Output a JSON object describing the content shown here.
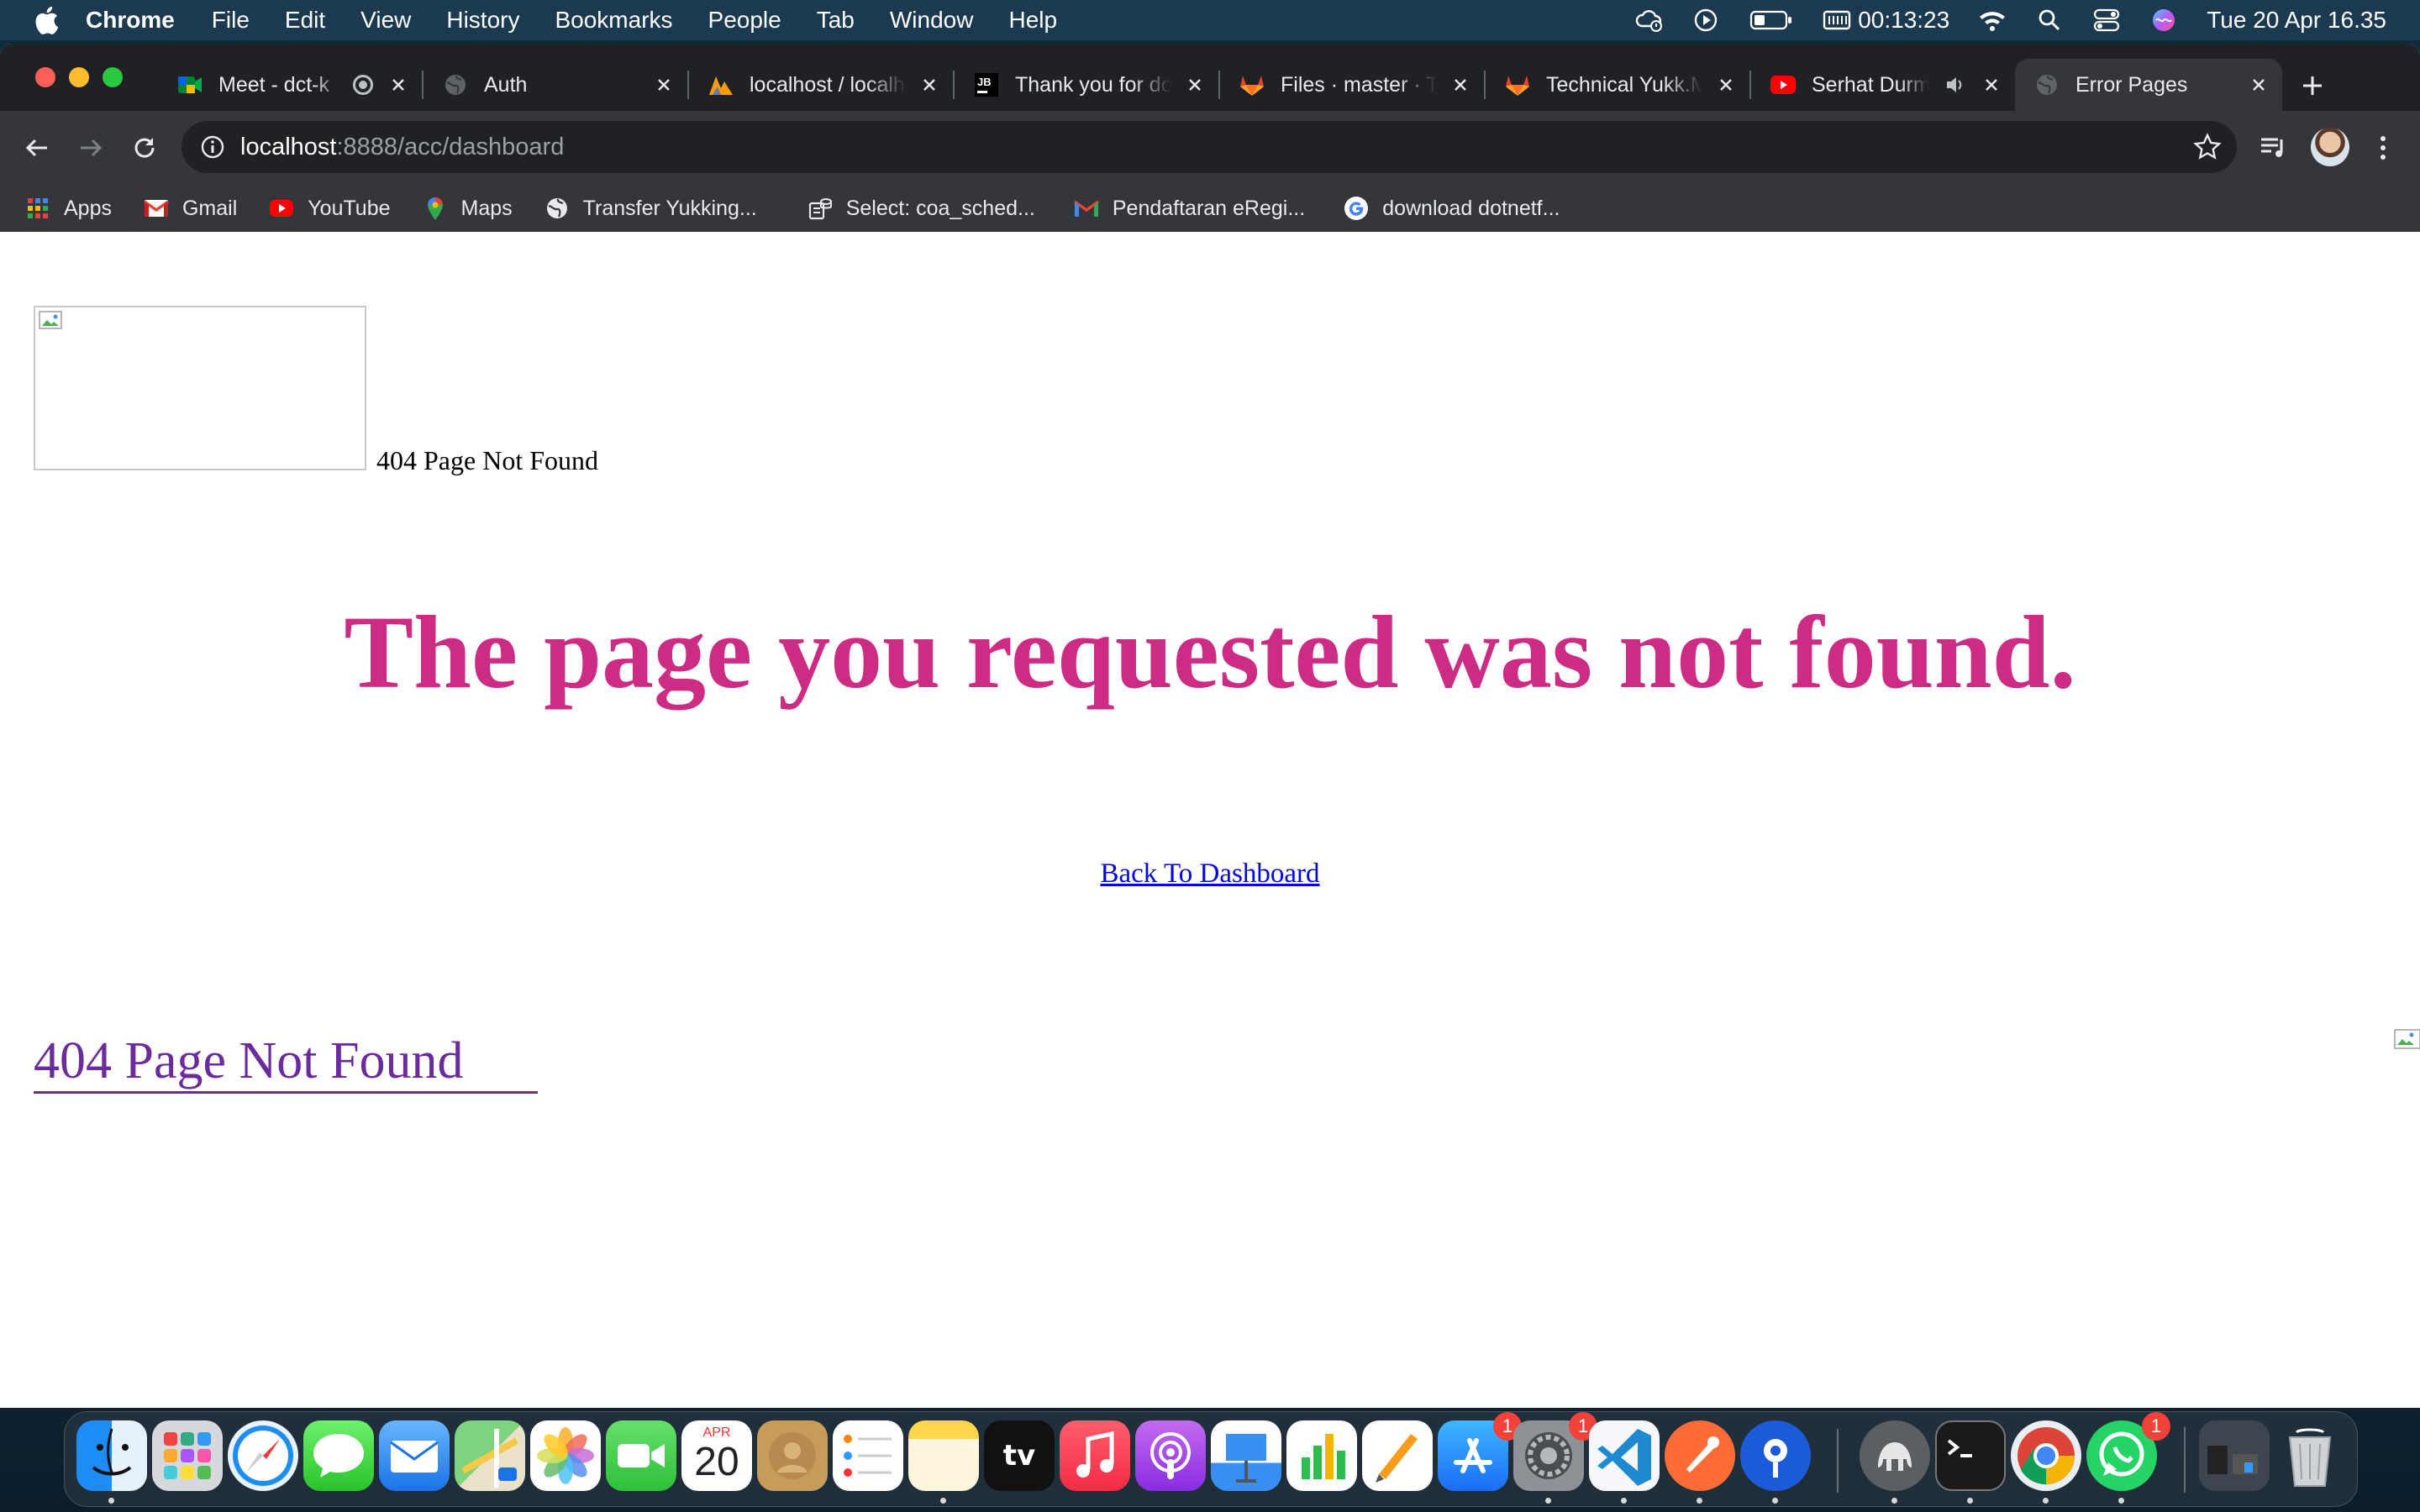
{
  "menubar": {
    "app_name": "Chrome",
    "items": [
      "File",
      "Edit",
      "View",
      "History",
      "Bookmarks",
      "People",
      "Tab",
      "Window",
      "Help"
    ],
    "timer": "00:13:23",
    "datetime": "Tue 20 Apr  16.35",
    "status_icons": [
      "cloud-sync-icon",
      "play-circle-icon",
      "battery-icon",
      "memory-icon",
      "wifi-icon",
      "spotlight-search-icon",
      "control-center-icon",
      "siri-icon"
    ]
  },
  "tabs": [
    {
      "title": "Meet - dct-k",
      "icon": "google-meet-icon",
      "recording": true
    },
    {
      "title": "Auth",
      "icon": "globe-icon"
    },
    {
      "title": "localhost / localh",
      "icon": "phpmyadmin-icon"
    },
    {
      "title": "Thank you for do",
      "icon": "jetbrains-icon"
    },
    {
      "title": "Files · master · T",
      "icon": "gitlab-icon"
    },
    {
      "title": "Technical Yukk.M",
      "icon": "gitlab-icon"
    },
    {
      "title": "Serhat Durm",
      "icon": "youtube-icon",
      "audio": true
    },
    {
      "title": "Error Pages",
      "icon": "globe-icon",
      "active": true
    }
  ],
  "omnibox": {
    "host": "localhost",
    "path": ":8888/acc/dashboard"
  },
  "bookmarks": [
    {
      "label": "Apps",
      "icon": "apps-grid-icon"
    },
    {
      "label": "Gmail",
      "icon": "gmail-icon"
    },
    {
      "label": "YouTube",
      "icon": "youtube-icon"
    },
    {
      "label": "Maps",
      "icon": "maps-pin-icon"
    },
    {
      "label": "Transfer Yukking...",
      "icon": "globe-icon"
    },
    {
      "label": "Select: coa_sched...",
      "icon": "database-icon"
    },
    {
      "label": "Pendaftaran eRegi...",
      "icon": "gmail-icon"
    },
    {
      "label": "download dotnetf...",
      "icon": "google-icon"
    }
  ],
  "page": {
    "logo_alt": "404 Page Not Found",
    "headline": "The page you requested was not found.",
    "back_link": "Back To Dashboard",
    "footer_title": "404 Page Not Found"
  },
  "dock": {
    "apps": [
      {
        "name": "finder-icon",
        "running": true
      },
      {
        "name": "launchpad-icon"
      },
      {
        "name": "safari-icon"
      },
      {
        "name": "messages-icon"
      },
      {
        "name": "mail-icon"
      },
      {
        "name": "maps-icon"
      },
      {
        "name": "photos-icon"
      },
      {
        "name": "facetime-icon"
      },
      {
        "name": "calendar-icon",
        "month": "APR",
        "day": "20"
      },
      {
        "name": "contacts-icon"
      },
      {
        "name": "reminders-icon"
      },
      {
        "name": "notes-icon",
        "running": true
      },
      {
        "name": "apple-tv-icon",
        "label": "tv"
      },
      {
        "name": "music-icon"
      },
      {
        "name": "podcasts-icon"
      },
      {
        "name": "keynote-icon"
      },
      {
        "name": "numbers-icon"
      },
      {
        "name": "pages-icon"
      },
      {
        "name": "app-store-icon",
        "badge": "1"
      },
      {
        "name": "system-preferences-icon",
        "badge": "1",
        "running": true
      },
      {
        "name": "vscode-icon",
        "running": true
      },
      {
        "name": "postman-icon",
        "running": true
      },
      {
        "name": "proxyman-icon",
        "running": true
      },
      {
        "name": "tableplus-icon",
        "running": true
      },
      {
        "name": "terminal-icon",
        "running": true
      },
      {
        "name": "chrome-icon",
        "running": true
      },
      {
        "name": "whatsapp-icon",
        "badge": "1",
        "running": true
      },
      {
        "name": "downloads-stack-icon"
      },
      {
        "name": "trash-icon"
      }
    ]
  },
  "colors": {
    "headline": "#cc2c83",
    "link": "#0000ee",
    "footer_title": "#6a2c9d",
    "chrome_dark": "#202124",
    "chrome_toolbar": "#35363a"
  }
}
